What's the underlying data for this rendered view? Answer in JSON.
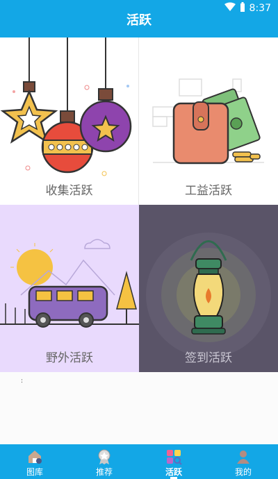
{
  "status_bar": {
    "time": "8:37"
  },
  "app_bar": {
    "title": "活跃"
  },
  "tiles": [
    {
      "label": "收集活跃",
      "illustration": "christmas-ornaments"
    },
    {
      "label": "工益活跃",
      "illustration": "wallet-money"
    },
    {
      "label": "野外活跃",
      "illustration": "camper-van"
    },
    {
      "label": "签到活跃",
      "illustration": "lantern"
    }
  ],
  "placeholder_text": ":",
  "bottom_nav": {
    "items": [
      {
        "label": "图库",
        "icon": "home-icon"
      },
      {
        "label": "推荐",
        "icon": "medal-icon"
      },
      {
        "label": "活跃",
        "icon": "tiles-icon",
        "active": true
      },
      {
        "label": "我的",
        "icon": "user-icon"
      }
    ]
  },
  "colors": {
    "accent": "#13a7e6"
  }
}
